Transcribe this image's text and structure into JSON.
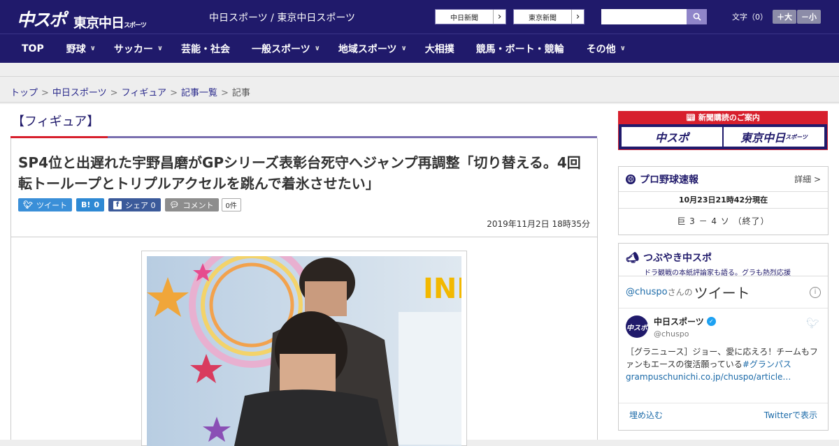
{
  "header": {
    "logo_main": "中スポ",
    "logo_sub": "東京中日",
    "logo_sub_small": "スポーツ",
    "site_title": "中日スポーツ / 東京中日スポーツ",
    "link_chunichi": "中日新聞",
    "link_tokyo": "東京新聞",
    "search_placeholder": "",
    "font_label": "文字（0）",
    "font_bigger": "＋大",
    "font_smaller": "－小"
  },
  "nav": [
    {
      "label": "TOP",
      "dropdown": false
    },
    {
      "label": "野球",
      "dropdown": true
    },
    {
      "label": "サッカー",
      "dropdown": true
    },
    {
      "label": "芸能・社会",
      "dropdown": false
    },
    {
      "label": "一般スポーツ",
      "dropdown": true
    },
    {
      "label": "地域スポーツ",
      "dropdown": true
    },
    {
      "label": "大相撲",
      "dropdown": false
    },
    {
      "label": "競馬・ボート・競輪",
      "dropdown": false
    },
    {
      "label": "その他",
      "dropdown": true
    }
  ],
  "breadcrumb": {
    "items": [
      "トップ",
      "中日スポーツ",
      "フィギュア",
      "記事一覧"
    ],
    "current": "記事",
    "separator": ">"
  },
  "article": {
    "category": "【フィギュア】",
    "headline": "SP4位と出遅れた宇野昌磨がGPシリーズ表彰台死守へジャンプ再調整「切り替える。4回転トーループとトリプルアクセルを跳んで着氷させたい」",
    "date": "2019年11月2日 18時35分",
    "share": {
      "tweet": "ツイート",
      "hatena_icon": "B!",
      "hatena_count": "0",
      "facebook": "シェア 0",
      "comment": "コメント",
      "comment_count": "0件"
    }
  },
  "sidebar": {
    "ad_heading": "新聞購読のご案内",
    "ad_logo_1": "中スポ",
    "ad_logo_2": "東京中日",
    "ad_logo_2_small": "スポーツ",
    "baseball": {
      "title": "プロ野球速報",
      "more": "詳細 >",
      "time": "10月23日21時42分現在",
      "score": "巨 3 － 4 ソ （終了）"
    },
    "tweets": {
      "title": "つぶやき中スポ",
      "subtitle": "ドラ観戦の本紙評論家も語る。グラも熱烈応援",
      "handle": "@chuspo",
      "handle_suffix": "さんの",
      "word": "ツイート",
      "user_name": "中日スポーツ",
      "user_id": "@chuspo",
      "avatar_text": "中スポ",
      "text_before": "［グラニュース］ジョー、愛に応えろ！チームもファンもエースの復活願っている",
      "text_tag": "#グランパス",
      "text_link": "grampuschunichi.co.jp/chuspo/article…",
      "embed": "埋め込む",
      "view_on_twitter": "Twitterで表示"
    }
  },
  "colors": {
    "brand_navy": "#201a6b",
    "accent_red": "#d71f2d",
    "link_blue": "#1b6aa8"
  }
}
